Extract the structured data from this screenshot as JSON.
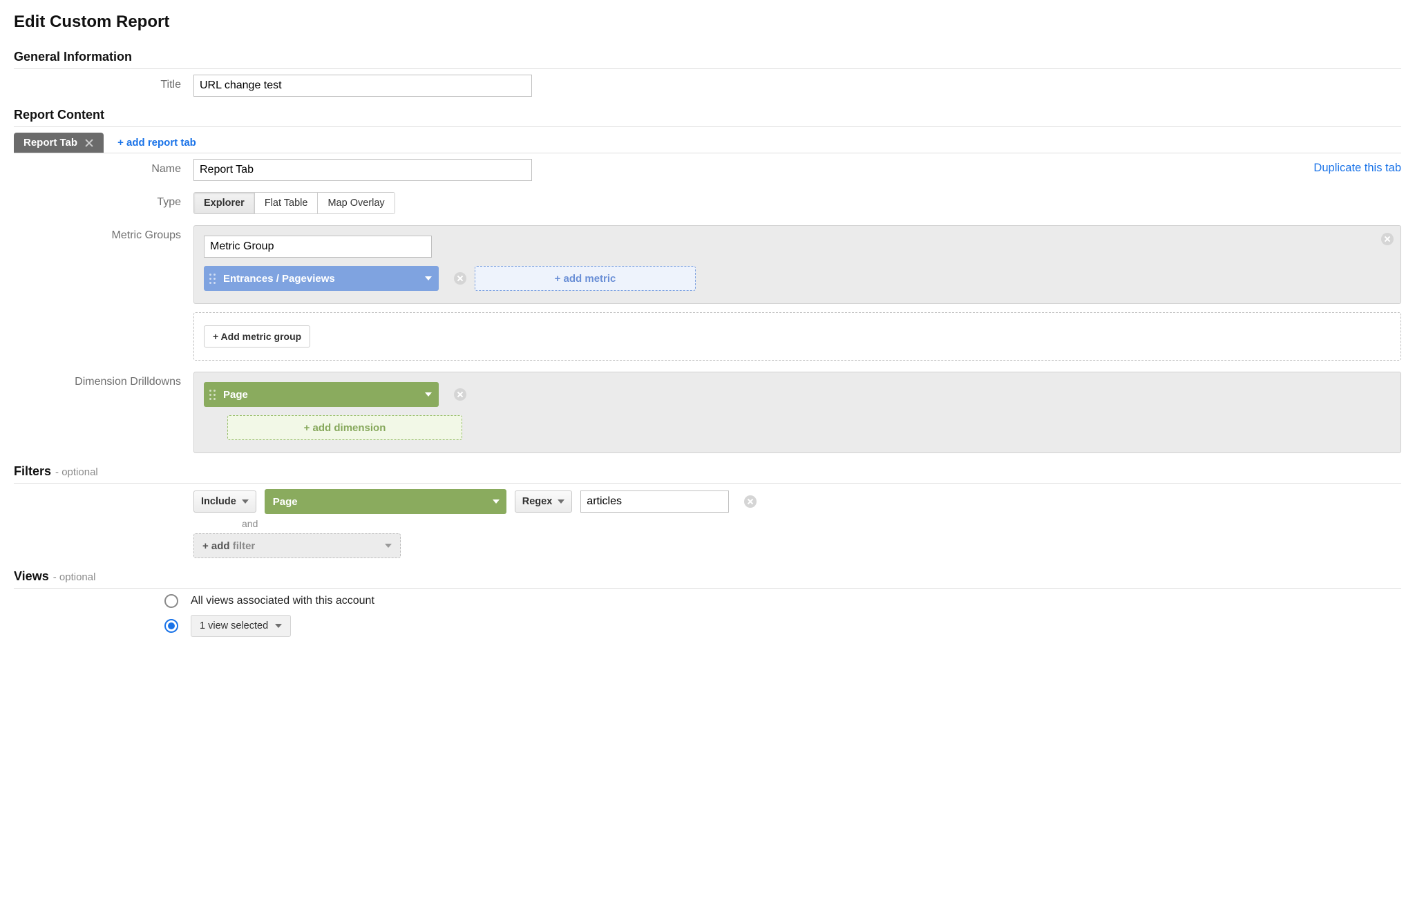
{
  "page": {
    "title": "Edit Custom Report"
  },
  "sections": {
    "general": {
      "header": "General Information",
      "title_label": "Title"
    },
    "content": {
      "header": "Report Content"
    },
    "filters": {
      "header": "Filters",
      "optional": "- optional"
    },
    "views": {
      "header": "Views",
      "optional": "- optional"
    }
  },
  "general": {
    "title_value": "URL change test"
  },
  "tabs": {
    "active_label": "Report Tab",
    "add_tab": "+ add report tab",
    "duplicate": "Duplicate this tab"
  },
  "report_tab": {
    "name_label": "Name",
    "name_value": "Report Tab",
    "type_label": "Type",
    "type_options": {
      "explorer": "Explorer",
      "flat": "Flat Table",
      "map": "Map Overlay"
    },
    "active_type": "explorer",
    "metric_groups_label": "Metric Groups",
    "metric_group_name": "Metric Group",
    "metric_pill": "Entrances / Pageviews",
    "add_metric": "+ add metric",
    "add_metric_group": "+ Add metric group",
    "dim_label": "Dimension Drilldowns",
    "dim_pill": "Page",
    "add_dimension": "+ add dimension"
  },
  "filters": {
    "include": "Include",
    "dimension": "Page",
    "match": "Regex",
    "value": "articles",
    "and": "and",
    "add_prefix": "+ add ",
    "add_word": "filter"
  },
  "views": {
    "all_label": "All views associated with this account",
    "selected_label": "1 view selected"
  }
}
